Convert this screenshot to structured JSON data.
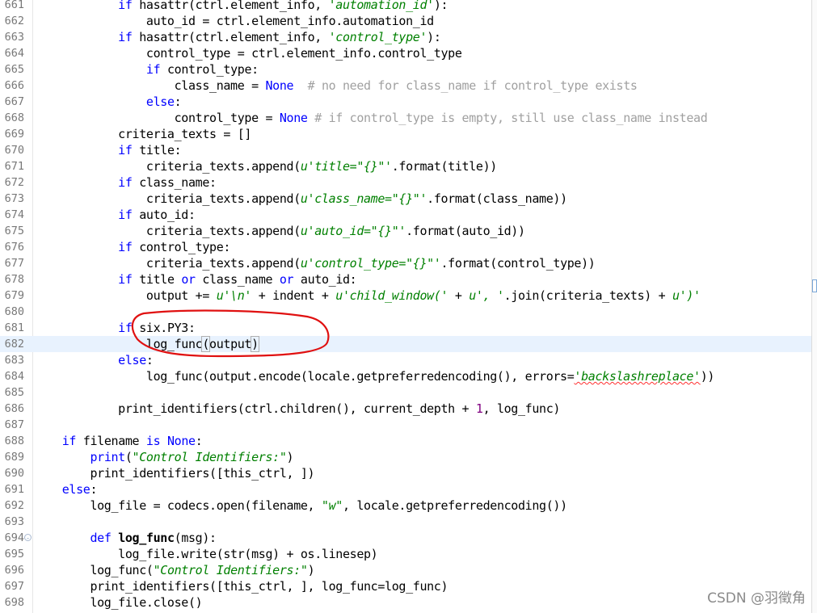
{
  "editor": {
    "current_line_index": 21,
    "lines": [
      {
        "no": "661",
        "parts": [
          [
            "",
            "            "
          ],
          [
            "kw",
            "if"
          ],
          [
            "",
            " hasattr(ctrl.element_info, "
          ],
          [
            "str",
            "'automation_id'"
          ],
          [
            "",
            "):"
          ]
        ]
      },
      {
        "no": "662",
        "parts": [
          [
            "",
            "                auto_id = ctrl.element_info.automation_id"
          ]
        ]
      },
      {
        "no": "663",
        "parts": [
          [
            "",
            "            "
          ],
          [
            "kw",
            "if"
          ],
          [
            "",
            " hasattr(ctrl.element_info, "
          ],
          [
            "str",
            "'control_type'"
          ],
          [
            "",
            "):"
          ]
        ]
      },
      {
        "no": "664",
        "parts": [
          [
            "",
            "                control_type = ctrl.element_info.control_type"
          ]
        ]
      },
      {
        "no": "665",
        "parts": [
          [
            "",
            "                "
          ],
          [
            "kw",
            "if"
          ],
          [
            "",
            " control_type:"
          ]
        ]
      },
      {
        "no": "666",
        "parts": [
          [
            "",
            "                    class_name = "
          ],
          [
            "kw",
            "None"
          ],
          [
            "",
            "  "
          ],
          [
            "cm",
            "# no need for class_name if control_type exists"
          ]
        ]
      },
      {
        "no": "667",
        "parts": [
          [
            "",
            "                "
          ],
          [
            "kw",
            "else"
          ],
          [
            "",
            ":"
          ]
        ]
      },
      {
        "no": "668",
        "parts": [
          [
            "",
            "                    control_type = "
          ],
          [
            "kw",
            "None"
          ],
          [
            "",
            " "
          ],
          [
            "cm",
            "# if control_type is empty, still use class_name instead"
          ]
        ]
      },
      {
        "no": "669",
        "parts": [
          [
            "",
            "            criteria_texts = []"
          ]
        ]
      },
      {
        "no": "670",
        "parts": [
          [
            "",
            "            "
          ],
          [
            "kw",
            "if"
          ],
          [
            "",
            " title:"
          ]
        ]
      },
      {
        "no": "671",
        "parts": [
          [
            "",
            "                criteria_texts.append("
          ],
          [
            "str",
            "u'title=\"{}\"'"
          ],
          [
            "",
            ".format(title))"
          ]
        ]
      },
      {
        "no": "672",
        "parts": [
          [
            "",
            "            "
          ],
          [
            "kw",
            "if"
          ],
          [
            "",
            " class_name:"
          ]
        ]
      },
      {
        "no": "673",
        "parts": [
          [
            "",
            "                criteria_texts.append("
          ],
          [
            "str",
            "u'class_name=\"{}\"'"
          ],
          [
            "",
            ".format(class_name))"
          ]
        ]
      },
      {
        "no": "674",
        "parts": [
          [
            "",
            "            "
          ],
          [
            "kw",
            "if"
          ],
          [
            "",
            " auto_id:"
          ]
        ]
      },
      {
        "no": "675",
        "parts": [
          [
            "",
            "                criteria_texts.append("
          ],
          [
            "str",
            "u'auto_id=\"{}\"'"
          ],
          [
            "",
            ".format(auto_id))"
          ]
        ]
      },
      {
        "no": "676",
        "parts": [
          [
            "",
            "            "
          ],
          [
            "kw",
            "if"
          ],
          [
            "",
            " control_type:"
          ]
        ]
      },
      {
        "no": "677",
        "parts": [
          [
            "",
            "                criteria_texts.append("
          ],
          [
            "str",
            "u'control_type=\"{}\"'"
          ],
          [
            "",
            ".format(control_type))"
          ]
        ]
      },
      {
        "no": "678",
        "parts": [
          [
            "",
            "            "
          ],
          [
            "kw",
            "if"
          ],
          [
            "",
            " title "
          ],
          [
            "kw",
            "or"
          ],
          [
            "",
            " class_name "
          ],
          [
            "kw",
            "or"
          ],
          [
            "",
            " auto_id:"
          ]
        ]
      },
      {
        "no": "679",
        "parts": [
          [
            "",
            "                output += "
          ],
          [
            "str",
            "u'\\n'"
          ],
          [
            "",
            " + indent + "
          ],
          [
            "str",
            "u'child_window('"
          ],
          [
            "",
            " + "
          ],
          [
            "str",
            "u', '"
          ],
          [
            "",
            ".join(criteria_texts) + "
          ],
          [
            "str",
            "u')'"
          ]
        ]
      },
      {
        "no": "680",
        "parts": []
      },
      {
        "no": "681",
        "parts": [
          [
            "",
            "            "
          ],
          [
            "kw",
            "if"
          ],
          [
            "",
            " six.PY3:"
          ]
        ]
      },
      {
        "no": "682",
        "parts": [
          [
            "",
            "                log_func"
          ],
          [
            "bracket",
            "("
          ],
          [
            "",
            "output"
          ],
          [
            "bracket",
            ")"
          ],
          [
            "caret",
            ""
          ]
        ]
      },
      {
        "no": "683",
        "parts": [
          [
            "",
            "            "
          ],
          [
            "kw",
            "else"
          ],
          [
            "",
            ":"
          ]
        ]
      },
      {
        "no": "684",
        "parts": [
          [
            "",
            "                log_func(output.encode(locale.getpreferredencoding(), errors="
          ],
          [
            "str squig",
            "'backslashreplace'"
          ],
          [
            "",
            "))"
          ]
        ]
      },
      {
        "no": "685",
        "parts": []
      },
      {
        "no": "686",
        "parts": [
          [
            "",
            "            print_identifiers(ctrl.children(), current_depth + "
          ],
          [
            "num",
            "1"
          ],
          [
            "",
            ", log_func)"
          ]
        ]
      },
      {
        "no": "687",
        "parts": []
      },
      {
        "no": "688",
        "parts": [
          [
            "",
            "    "
          ],
          [
            "kw",
            "if"
          ],
          [
            "",
            " filename "
          ],
          [
            "kw",
            "is"
          ],
          [
            "",
            " "
          ],
          [
            "kw",
            "None"
          ],
          [
            "",
            ":"
          ]
        ]
      },
      {
        "no": "689",
        "parts": [
          [
            "",
            "        "
          ],
          [
            "kw",
            "print"
          ],
          [
            "",
            "("
          ],
          [
            "str",
            "\"Control Identifiers:\""
          ],
          [
            "",
            ")"
          ]
        ]
      },
      {
        "no": "690",
        "parts": [
          [
            "",
            "        print_identifiers([this_ctrl, ])"
          ]
        ]
      },
      {
        "no": "691",
        "parts": [
          [
            "",
            "    "
          ],
          [
            "kw",
            "else"
          ],
          [
            "",
            ":"
          ]
        ]
      },
      {
        "no": "692",
        "parts": [
          [
            "",
            "        log_file = codecs.open(filename, "
          ],
          [
            "str",
            "\"w\""
          ],
          [
            "",
            ", locale.getpreferredencoding())"
          ]
        ]
      },
      {
        "no": "693",
        "parts": []
      },
      {
        "no": "694",
        "fold": true,
        "parts": [
          [
            "",
            "        "
          ],
          [
            "kw",
            "def"
          ],
          [
            "",
            " "
          ],
          [
            "bold",
            "log_func"
          ],
          [
            "",
            "(msg):"
          ]
        ]
      },
      {
        "no": "695",
        "parts": [
          [
            "",
            "            log_file.write(str(msg) + os.linesep)"
          ]
        ]
      },
      {
        "no": "696",
        "parts": [
          [
            "",
            "        log_func("
          ],
          [
            "str",
            "\"Control Identifiers:\""
          ],
          [
            "",
            ")"
          ]
        ]
      },
      {
        "no": "697",
        "parts": [
          [
            "",
            "        print_identifiers([this_ctrl, ], log_func=log_func)"
          ]
        ]
      },
      {
        "no": "698",
        "parts": [
          [
            "",
            "        log_file.close()"
          ]
        ]
      }
    ]
  },
  "fold_glyph": "⊖",
  "watermark": "CSDN @羽徵角",
  "colors": {
    "keyword": "#0000ff",
    "string": "#008000",
    "comment": "#a0a0a0",
    "number": "#800080",
    "annotation": "#e01010"
  }
}
